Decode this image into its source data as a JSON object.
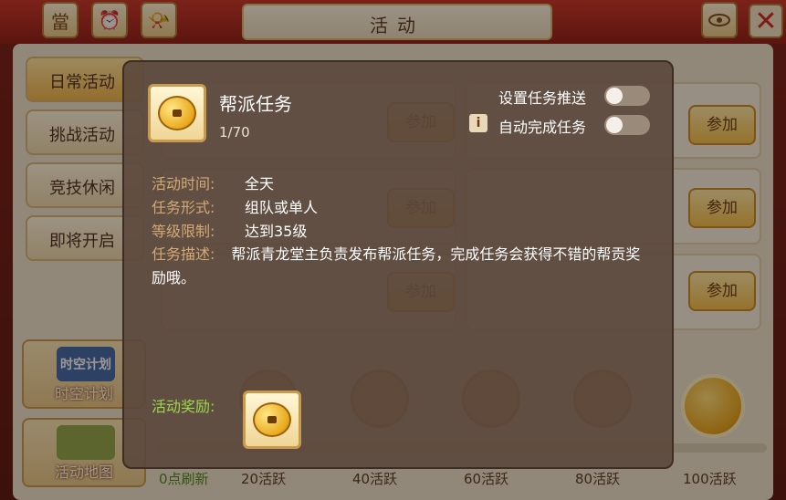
{
  "window": {
    "title": "活动",
    "close_glyph": "✕"
  },
  "top_icons": [
    {
      "name": "calendar-icon",
      "glyph": "當"
    },
    {
      "name": "clock-icon",
      "glyph": "⏰"
    },
    {
      "name": "horn-icon",
      "glyph": "📯"
    }
  ],
  "side_tabs": [
    {
      "label": "日常活动",
      "active": true
    },
    {
      "label": "挑战活动",
      "active": false
    },
    {
      "label": "竞技休闲",
      "active": false
    },
    {
      "label": "即将开启",
      "active": false
    }
  ],
  "side_buttons": [
    {
      "label": "时空计划",
      "banner": "时空计划"
    },
    {
      "label": "活动地图"
    }
  ],
  "activities": [
    {
      "label": "参加"
    },
    {
      "label": "参加"
    },
    {
      "label": "参加"
    },
    {
      "label": "参加"
    },
    {
      "label": "参加"
    },
    {
      "label": "参加"
    }
  ],
  "progress": {
    "refresh": "0点刷新",
    "milestones": [
      "20活跃",
      "40活跃",
      "60活跃",
      "80活跃",
      "100活跃"
    ],
    "fill_fraction": 0.0
  },
  "popup": {
    "title": "帮派任务",
    "count": "1/70",
    "push_label": "设置任务推送",
    "auto_label": "自动完成任务",
    "push_on": false,
    "auto_on": false,
    "info_glyph": "i",
    "fields": [
      {
        "label": "活动时间:",
        "value": "全天"
      },
      {
        "label": "任务形式:",
        "value": "组队或单人"
      },
      {
        "label": "等级限制:",
        "value": "达到35级"
      }
    ],
    "desc_label": "任务描述:",
    "desc_text": "帮派青龙堂主负责发布帮派任务，完成任务会获得不错的帮贡奖励哦。",
    "reward_label": "活动奖励:"
  }
}
